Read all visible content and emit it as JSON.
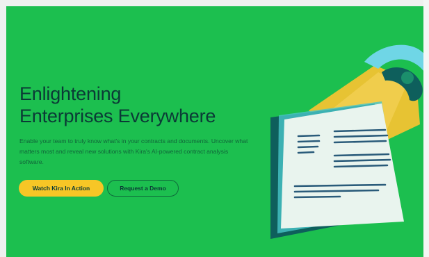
{
  "hero": {
    "headline_line1": "Enlightening",
    "headline_line2": "Enterprises Everywhere",
    "subtext": "Enable your team to truly know what's in your contracts and documents. Uncover what matters most and reveal new solutions with Kira's AI-powered contract analysis software.",
    "primary_cta": "Watch Kira In Action",
    "secondary_cta": "Request a Demo"
  },
  "colors": {
    "background_green": "#1cbf4f",
    "headline_text": "#0b3a36",
    "primary_button": "#f7c626",
    "light_beam": "#f2c332",
    "document_paper": "#e9f4ee",
    "document_back": "#0e5f5c",
    "icon_cyan": "#6fd6e6"
  },
  "illustration": {
    "icon_names": [
      "lightbulb-icon",
      "document-icon"
    ]
  }
}
